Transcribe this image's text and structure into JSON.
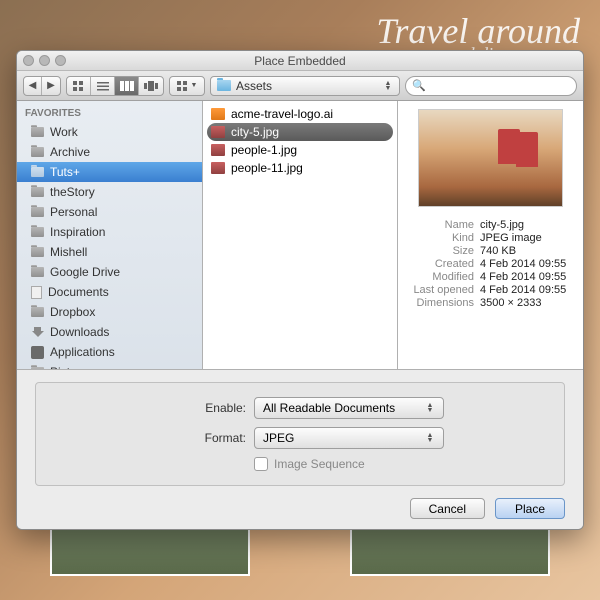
{
  "bg": {
    "line1": "Travel around",
    "line2": "and discover"
  },
  "window": {
    "title": "Place Embedded"
  },
  "toolbar": {
    "path_label": "Assets"
  },
  "sidebar": {
    "header": "FAVORITES",
    "items": [
      {
        "label": "Work"
      },
      {
        "label": "Archive"
      },
      {
        "label": "Tuts+"
      },
      {
        "label": "theStory"
      },
      {
        "label": "Personal"
      },
      {
        "label": "Inspiration"
      },
      {
        "label": "Mishell"
      },
      {
        "label": "Google Drive"
      },
      {
        "label": "Documents"
      },
      {
        "label": "Dropbox"
      },
      {
        "label": "Downloads"
      },
      {
        "label": "Applications"
      },
      {
        "label": "Pictures"
      }
    ],
    "selected_index": 2
  },
  "files": {
    "items": [
      {
        "label": "acme-travel-logo.ai",
        "type": "ai"
      },
      {
        "label": "city-5.jpg",
        "type": "jpg"
      },
      {
        "label": "people-1.jpg",
        "type": "jpg"
      },
      {
        "label": "people-11.jpg",
        "type": "jpg"
      }
    ],
    "selected_index": 1
  },
  "preview": {
    "rows": [
      {
        "label": "Name",
        "value": "city-5.jpg"
      },
      {
        "label": "Kind",
        "value": "JPEG image"
      },
      {
        "label": "Size",
        "value": "740 KB"
      },
      {
        "label": "Created",
        "value": "4 Feb 2014 09:55"
      },
      {
        "label": "Modified",
        "value": "4 Feb 2014 09:55"
      },
      {
        "label": "Last opened",
        "value": "4 Feb 2014 09:55"
      },
      {
        "label": "Dimensions",
        "value": "3500 × 2333"
      }
    ]
  },
  "options": {
    "enable_label": "Enable:",
    "enable_value": "All Readable Documents",
    "format_label": "Format:",
    "format_value": "JPEG",
    "sequence_label": "Image Sequence"
  },
  "buttons": {
    "cancel": "Cancel",
    "confirm": "Place"
  }
}
